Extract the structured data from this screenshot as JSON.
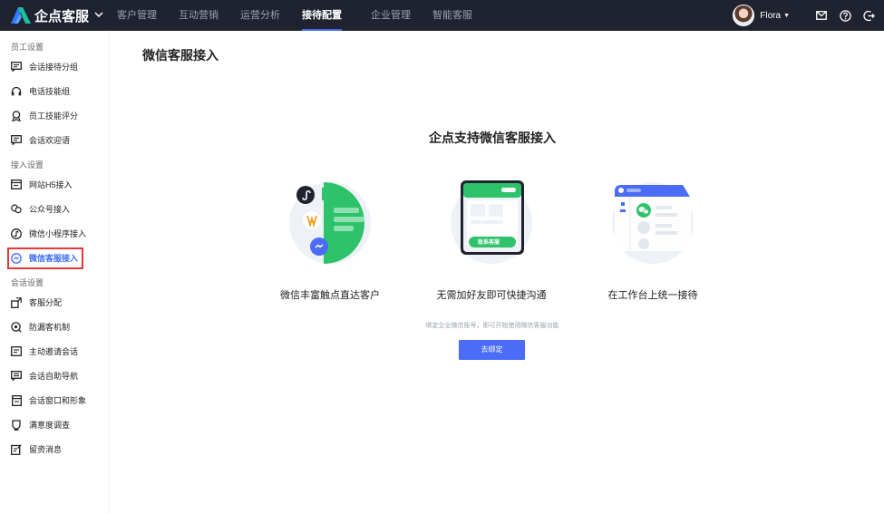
{
  "brand": {
    "name": "企点客服"
  },
  "nav": {
    "items": [
      {
        "label": "客户管理"
      },
      {
        "label": "互动营销"
      },
      {
        "label": "运营分析"
      },
      {
        "label": "接待配置",
        "active": true
      },
      {
        "label": "企业管理"
      },
      {
        "label": "智能客服"
      }
    ]
  },
  "user": {
    "name": "Flora"
  },
  "sidebar": {
    "groups": [
      {
        "title": "员工设置",
        "items": [
          {
            "label": "会话接待分组",
            "icon": "chat-list-icon"
          },
          {
            "label": "电话技能组",
            "icon": "headset-icon"
          },
          {
            "label": "员工技能评分",
            "icon": "badge-icon"
          },
          {
            "label": "会话欢迎语",
            "icon": "message-icon"
          }
        ]
      },
      {
        "title": "接入设置",
        "items": [
          {
            "label": "网站H5接入",
            "icon": "window-icon"
          },
          {
            "label": "公众号接入",
            "icon": "official-account-icon"
          },
          {
            "label": "微信小程序接入",
            "icon": "mini-program-icon"
          },
          {
            "label": "微信客服接入",
            "icon": "wechat-service-icon",
            "active": true
          }
        ]
      },
      {
        "title": "会话设置",
        "items": [
          {
            "label": "客服分配",
            "icon": "assign-icon"
          },
          {
            "label": "防漏客机制",
            "icon": "anti-leak-icon"
          },
          {
            "label": "主动邀请会话",
            "icon": "invite-icon"
          },
          {
            "label": "会话自助导航",
            "icon": "navigation-icon"
          },
          {
            "label": "会话窗口和形象",
            "icon": "chat-window-icon"
          },
          {
            "label": "满意度调查",
            "icon": "survey-icon"
          },
          {
            "label": "留资消息",
            "icon": "lead-form-icon"
          }
        ]
      }
    ]
  },
  "main": {
    "page_title": "微信客服接入",
    "hero_title": "企点支持微信客服接入",
    "features": [
      {
        "label": "微信丰富触点直达客户"
      },
      {
        "label": "无需加好友即可快捷沟通",
        "button_text": "联系客服"
      },
      {
        "label": "在工作台上统一接待"
      }
    ],
    "hint": "绑定企业微信账号，即可开始使用微信客服功能",
    "bind_button": "去绑定"
  },
  "colors": {
    "accent": "#3b6cf6",
    "green": "#2ec26a",
    "topbar": "#1f2330",
    "button": "#4a6cf7",
    "highlight": "#e53935"
  }
}
